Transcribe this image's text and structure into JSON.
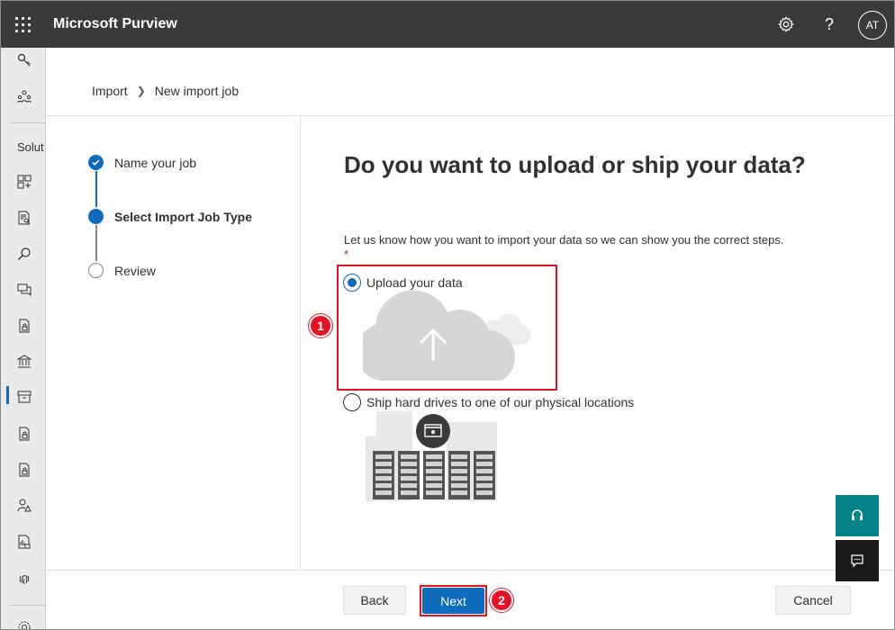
{
  "app": {
    "title": "Microsoft Purview",
    "user_initials": "AT",
    "icons": [
      "waffle-icon",
      "settings-icon",
      "help-icon"
    ]
  },
  "nav": {
    "section_heading": "Solut",
    "icons": [
      "key-icon",
      "org-icon",
      "grid-add-icon",
      "document-search-icon",
      "search-icon",
      "chat-icon",
      "lock-document-icon",
      "bank-icon",
      "archive-icon",
      "lock-document-2-icon",
      "lock-document-3-icon",
      "person-warning-icon",
      "report-lock-icon",
      "fingerprint-icon",
      "settings-icon"
    ],
    "active": "archive-icon"
  },
  "breadcrumb": {
    "items": [
      "Import",
      "New import job"
    ]
  },
  "steps": [
    {
      "label": "Name your job",
      "state": "done"
    },
    {
      "label": "Select Import Job Type",
      "state": "current"
    },
    {
      "label": "Review",
      "state": "todo"
    }
  ],
  "content": {
    "title": "Do you want to upload or ship your data?",
    "description": "Let us know how you want to import your data so we can show you the correct steps.",
    "required_mark": "*",
    "options": [
      {
        "label": "Upload your data",
        "selected": true
      },
      {
        "label": "Ship hard drives to one of our physical locations",
        "selected": false
      }
    ]
  },
  "callouts": [
    "1",
    "2"
  ],
  "footer": {
    "back_label": "Back",
    "next_label": "Next",
    "cancel_label": "Cancel"
  },
  "colors": {
    "accent": "#0f6cbd",
    "topbar": "#3b3a39",
    "highlight": "#e81123",
    "float_teal": "#038387",
    "float_dark": "#1b1a19"
  }
}
